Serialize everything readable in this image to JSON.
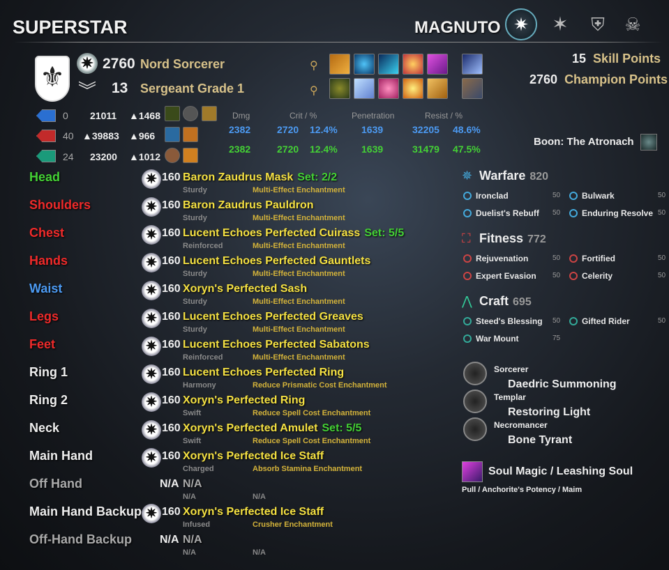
{
  "player_name": "SUPERSTAR",
  "character_name": "MAGNUTO",
  "header_icons": [
    "active-alliance-emblem-icon",
    "star-emblem-icon",
    "shield-emblem-icon",
    "skull-emblem-icon"
  ],
  "profile": {
    "cp": "2760",
    "race_class": "Nord Sorcerer",
    "rank": "13",
    "rank_title": "Sergeant Grade 1"
  },
  "points": {
    "skill_value": "15",
    "skill_label": "Skill Points",
    "champion_value": "2760",
    "champion_label": "Champion Points"
  },
  "resources": [
    {
      "color": "#2a6fd1",
      "value": "0",
      "max": "21011",
      "recovery": "▲1468"
    },
    {
      "color": "#c22a2a",
      "value": "40",
      "max": "▲39883",
      "recovery": "▲966"
    },
    {
      "color": "#1a9a7a",
      "value": "24",
      "max": "23200",
      "recovery": "▲1012"
    }
  ],
  "combat": {
    "headers": {
      "dmg": "Dmg",
      "crit": "Crit / %",
      "pen": "Penetration",
      "resist": "Resist / %"
    },
    "spell": {
      "dmg": "2382",
      "crit": "2720",
      "crit_pct": "12.4%",
      "pen": "1639",
      "resist": "32205",
      "resist_pct": "48.6%"
    },
    "weapon": {
      "dmg": "2382",
      "crit": "2720",
      "crit_pct": "12.4%",
      "pen": "1639",
      "resist": "31479",
      "resist_pct": "47.5%"
    }
  },
  "boon": "Boon: The Atronach",
  "gear": [
    {
      "slot": "Head",
      "slot_color": "grn",
      "level": "160",
      "name": "Baron Zaudrus Mask",
      "set": "Set: 2/2",
      "trait": "Sturdy",
      "ench": "Multi-Effect Enchantment",
      "name_color": "yel"
    },
    {
      "slot": "Shoulders",
      "slot_color": "red",
      "level": "160",
      "name": "Baron Zaudrus Pauldron",
      "set": "",
      "trait": "Sturdy",
      "ench": "Multi-Effect Enchantment",
      "name_color": "yel"
    },
    {
      "slot": "Chest",
      "slot_color": "red",
      "level": "160",
      "name": "Lucent Echoes Perfected Cuirass",
      "set": "Set: 5/5",
      "trait": "Reinforced",
      "ench": "Multi-Effect Enchantment",
      "name_color": "yel"
    },
    {
      "slot": "Hands",
      "slot_color": "red",
      "level": "160",
      "name": "Lucent Echoes Perfected Gauntlets",
      "set": "",
      "trait": "Sturdy",
      "ench": "Multi-Effect Enchantment",
      "name_color": "yel"
    },
    {
      "slot": "Waist",
      "slot_color": "blu",
      "level": "160",
      "name": "Xoryn's Perfected Sash",
      "set": "",
      "trait": "Sturdy",
      "ench": "Multi-Effect Enchantment",
      "name_color": "yel"
    },
    {
      "slot": "Legs",
      "slot_color": "red",
      "level": "160",
      "name": "Lucent Echoes Perfected Greaves",
      "set": "",
      "trait": "Sturdy",
      "ench": "Multi-Effect Enchantment",
      "name_color": "yel"
    },
    {
      "slot": "Feet",
      "slot_color": "red",
      "level": "160",
      "name": "Lucent Echoes Perfected Sabatons",
      "set": "",
      "trait": "Reinforced",
      "ench": "Multi-Effect Enchantment",
      "name_color": "yel"
    },
    {
      "slot": "Ring 1",
      "slot_color": "wht",
      "level": "160",
      "name": "Lucent Echoes Perfected Ring",
      "set": "",
      "trait": "Harmony",
      "ench": "Reduce Prismatic Cost Enchantment",
      "name_color": "yel"
    },
    {
      "slot": "Ring 2",
      "slot_color": "wht",
      "level": "160",
      "name": "Xoryn's Perfected Ring",
      "set": "",
      "trait": "Swift",
      "ench": "Reduce Spell Cost Enchantment",
      "name_color": "yel"
    },
    {
      "slot": "Neck",
      "slot_color": "wht",
      "level": "160",
      "name": "Xoryn's Perfected Amulet",
      "set": "Set: 5/5",
      "trait": "Swift",
      "ench": "Reduce Spell Cost Enchantment",
      "name_color": "yel"
    },
    {
      "slot": "Main Hand",
      "slot_color": "wht",
      "level": "160",
      "name": "Xoryn's Perfected Ice Staff",
      "set": "",
      "trait": "Charged",
      "ench": "Absorb Stamina Enchantment",
      "name_color": "yel"
    },
    {
      "slot": "Off Hand",
      "slot_color": "gry",
      "level": "N/A",
      "name": "N/A",
      "set": "",
      "trait": "N/A",
      "ench": "N/A",
      "name_color": "gry"
    },
    {
      "slot": "Main Hand Backup",
      "slot_color": "wht",
      "level": "160",
      "name": "Xoryn's Perfected Ice Staff",
      "set": "",
      "trait": "Infused",
      "ench": "Crusher Enchantment",
      "name_color": "yel"
    },
    {
      "slot": "Off-Hand Backup",
      "slot_color": "gry",
      "level": "N/A",
      "name": "N/A",
      "set": "",
      "trait": "N/A",
      "ench": "N/A",
      "name_color": "gry"
    }
  ],
  "cp_trees": [
    {
      "name": "Warfare",
      "value": "820",
      "icon": "warfare-icon",
      "items": [
        [
          "Ironclad",
          "50"
        ],
        [
          "Bulwark",
          "50"
        ],
        [
          "Duelist's Rebuff",
          "50"
        ],
        [
          "Enduring Resolve",
          "50"
        ]
      ]
    },
    {
      "name": "Fitness",
      "value": "772",
      "icon": "fitness-icon",
      "items": [
        [
          "Rejuvenation",
          "50"
        ],
        [
          "Fortified",
          "50"
        ],
        [
          "Expert Evasion",
          "50"
        ],
        [
          "Celerity",
          "50"
        ]
      ]
    },
    {
      "name": "Craft",
      "value": "695",
      "icon": "craft-icon",
      "items": [
        [
          "Steed's Blessing",
          "50"
        ],
        [
          "Gifted Rider",
          "50"
        ],
        [
          "War Mount",
          "75"
        ]
      ]
    }
  ],
  "subclasses": [
    {
      "class": "Sorcerer",
      "line": "Daedric Summoning"
    },
    {
      "class": "Templar",
      "line": "Restoring Light"
    },
    {
      "class": "Necromancer",
      "line": "Bone Tyrant"
    }
  ],
  "mundus": {
    "title": "Soul Magic / Leashing Soul",
    "passives": "Pull / Anchorite's Potency / Maim"
  },
  "colors": {
    "gold": "#e9c84b",
    "green": "#44d135",
    "blue": "#4c9af2",
    "red": "#ef2a2a"
  }
}
